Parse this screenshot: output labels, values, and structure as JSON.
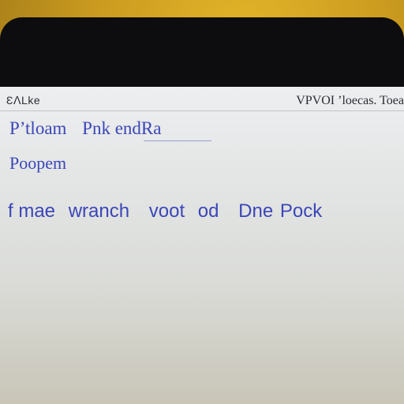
{
  "topbar": {
    "left_text": "ƐᐱLke",
    "right_text": "VPVOI ’loecas. Toea"
  },
  "lines": {
    "line1": {
      "a": "P’tloam",
      "b": "Pnk",
      "c": "endRa"
    },
    "line2": {
      "text": "Poopem"
    },
    "line3": {
      "a": "f mae",
      "b": "wranch",
      "c": "voot",
      "d": "od",
      "e": "Dne",
      "f": "Pock"
    }
  },
  "colors": {
    "text_blue": "#3b46b8",
    "frame": "#0d0d0f",
    "backdrop": "#c99a1f"
  }
}
